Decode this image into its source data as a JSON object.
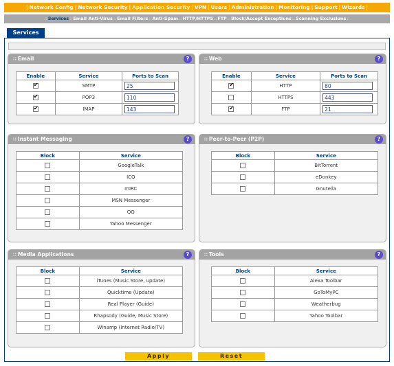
{
  "topnav": {
    "items": [
      "Network Config",
      "Network Security",
      "Application Security",
      "VPN",
      "Users",
      "Administration",
      "Monitoring",
      "Support",
      "Wizards"
    ],
    "active_index": 2
  },
  "subnav": {
    "items": [
      "Services",
      "Email Anti-Virus",
      "Email Filters",
      "Anti-Spam",
      "HTTP/HTTPS",
      "FTP",
      "Block/Accept Exceptions",
      "Scanning Exclusions"
    ],
    "active_index": 0
  },
  "page_tab": "Services",
  "help_glyph": "?",
  "email": {
    "title": "Email",
    "headers": [
      "Enable",
      "Service",
      "Ports to Scan"
    ],
    "rows": [
      {
        "enabled": true,
        "service": "SMTP",
        "port": "25"
      },
      {
        "enabled": true,
        "service": "POP3",
        "port": "110"
      },
      {
        "enabled": true,
        "service": "IMAP",
        "port": "143"
      }
    ]
  },
  "web": {
    "title": "Web",
    "headers": [
      "Enable",
      "Service",
      "Ports to Scan"
    ],
    "rows": [
      {
        "enabled": true,
        "service": "HTTP",
        "port": "80"
      },
      {
        "enabled": false,
        "service": "HTTPS",
        "port": "443"
      },
      {
        "enabled": true,
        "service": "FTP",
        "port": "21"
      }
    ]
  },
  "instant_messaging": {
    "title": "Instant Messaging",
    "headers": [
      "Block",
      "Service"
    ],
    "rows": [
      "GoogleTalk",
      "ICQ",
      "mIRC",
      "MSN Messenger",
      "QQ",
      "Yahoo Messenger"
    ]
  },
  "p2p": {
    "title": "Peer-to-Peer (P2P)",
    "headers": [
      "Block",
      "Service"
    ],
    "rows": [
      "BitTorrent",
      "eDonkey",
      "Gnutella"
    ]
  },
  "media": {
    "title": "Media Applications",
    "headers": [
      "Block",
      "Service"
    ],
    "rows": [
      "iTunes (Music Store, update)",
      "Quicktime (Update)",
      "Real Player (Guide)",
      "Rhapsody (Guide, Music Store)",
      "Winamp (Internet Radio/TV)"
    ]
  },
  "tools": {
    "title": "Tools",
    "headers": [
      "Block",
      "Service"
    ],
    "rows": [
      "Alexa Toolbar",
      "GoToMyPC",
      "Weatherbug",
      "Yahoo Toolbar"
    ]
  },
  "buttons": {
    "apply": "Apply",
    "reset": "Reset"
  }
}
